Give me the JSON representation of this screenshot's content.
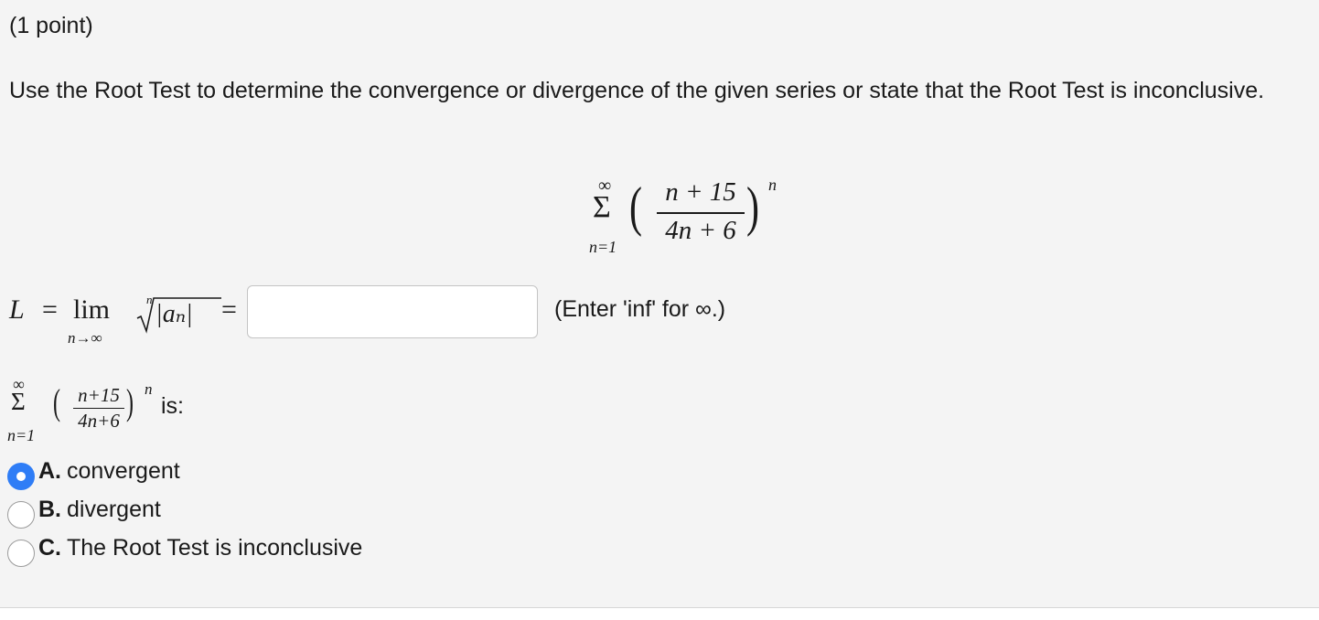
{
  "question": {
    "points": "(1 point)",
    "prompt": "Use the Root Test to determine the convergence or divergence of the given series or state that the Root Test is inconclusive."
  },
  "series": {
    "sum_symbol": "Σ",
    "upper": "∞",
    "lower": "n=1",
    "numerator": "n + 15",
    "denominator": "4n + 6",
    "exponent": "n"
  },
  "limit_formula": {
    "L": "L",
    "equals": "=",
    "lim": "lim",
    "lim_subscript": "n→∞",
    "root_index": "n",
    "abs_term": "|aₙ|",
    "equals2": "="
  },
  "answer_input": {
    "value": "",
    "placeholder": ""
  },
  "hint": "(Enter 'inf' for ∞.)",
  "second_part": {
    "sum_symbol": "Σ",
    "upper": "∞",
    "lower": "n=1",
    "numerator": "n+15",
    "denominator": "4n+6",
    "exponent": "n",
    "suffix": "is:"
  },
  "options": [
    {
      "letter": "A.",
      "label": "convergent",
      "selected": true
    },
    {
      "letter": "B.",
      "label": "divergent",
      "selected": false
    },
    {
      "letter": "C.",
      "label": "The Root Test is inconclusive",
      "selected": false
    }
  ],
  "colors": {
    "background": "#f4f4f4",
    "radio_selected": "#2f7df6",
    "input_border": "#c4c4c4"
  }
}
